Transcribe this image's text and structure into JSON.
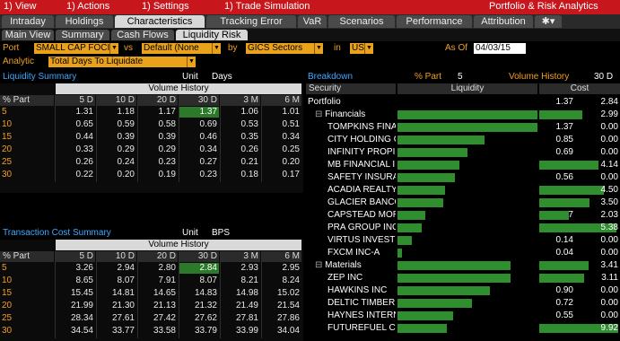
{
  "menu": {
    "view": "1) View",
    "actions": "1) Actions",
    "settings": "1) Settings",
    "trade_sim": "1) Trade Simulation",
    "app_title": "Portfolio & Risk Analytics"
  },
  "tabs": [
    "Intraday",
    "Holdings",
    "Characteristics",
    "Tracking Error",
    "VaR",
    "Scenarios",
    "Performance",
    "Attribution"
  ],
  "subtabs": [
    "Main View",
    "Summary",
    "Cash Flows",
    "Liquidity Risk"
  ],
  "filters": {
    "port_label": "Port",
    "port_value": "SMALL CAP FOCI",
    "vs_label": "vs",
    "vs_value": "Default (None",
    "by_label": "by",
    "by_value": "GICS Sectors",
    "in_label": "in",
    "in_value": "USD",
    "asof_label": "As Of",
    "asof_value": "04/03/15",
    "analytic_label": "Analytic",
    "analytic_value": "Total Days To Liquidate"
  },
  "liquidity_summary": {
    "title": "Liquidity Summary",
    "unit_label": "Unit",
    "unit_value": "Days",
    "group_header": "Volume History",
    "columns": [
      "% Part",
      "5 D",
      "10 D",
      "20 D",
      "30 D",
      "3 M",
      "6 M"
    ],
    "rows": [
      [
        "5",
        "1.31",
        "1.18",
        "1.17",
        "1.37",
        "1.06",
        "1.01"
      ],
      [
        "10",
        "0.65",
        "0.59",
        "0.58",
        "0.69",
        "0.53",
        "0.51"
      ],
      [
        "15",
        "0.44",
        "0.39",
        "0.39",
        "0.46",
        "0.35",
        "0.34"
      ],
      [
        "20",
        "0.33",
        "0.29",
        "0.29",
        "0.34",
        "0.26",
        "0.25"
      ],
      [
        "25",
        "0.26",
        "0.24",
        "0.23",
        "0.27",
        "0.21",
        "0.20"
      ],
      [
        "30",
        "0.22",
        "0.20",
        "0.19",
        "0.23",
        "0.18",
        "0.17"
      ]
    ]
  },
  "transaction_cost": {
    "title": "Transaction Cost Summary",
    "unit_label": "Unit",
    "unit_value": "BPS",
    "group_header": "Volume History",
    "columns": [
      "% Part",
      "5 D",
      "10 D",
      "20 D",
      "30 D",
      "3 M",
      "6 M"
    ],
    "rows": [
      [
        "5",
        "3.26",
        "2.94",
        "2.80",
        "2.84",
        "2.93",
        "2.95"
      ],
      [
        "10",
        "8.65",
        "8.07",
        "7.91",
        "8.07",
        "8.21",
        "8.24"
      ],
      [
        "15",
        "15.45",
        "14.81",
        "14.65",
        "14.83",
        "14.98",
        "15.02"
      ],
      [
        "20",
        "21.99",
        "21.30",
        "21.13",
        "21.32",
        "21.49",
        "21.54"
      ],
      [
        "25",
        "28.34",
        "27.61",
        "27.42",
        "27.62",
        "27.81",
        "27.86"
      ],
      [
        "30",
        "34.54",
        "33.77",
        "33.58",
        "33.79",
        "33.99",
        "34.04"
      ]
    ]
  },
  "breakdown": {
    "title": "Breakdown",
    "part_label": "% Part",
    "part_value": "5",
    "vol_label": "Volume History",
    "vol_value": "30 D",
    "columns": [
      "Security",
      "Liquidity",
      "Cost"
    ],
    "rows": [
      {
        "name": "Portfolio",
        "liq": "1.37",
        "cost": "2.84",
        "level": 0,
        "liqpct": 0,
        "costpct": 0
      },
      {
        "name": "Financials",
        "liq": "1.37",
        "cost": "2.99",
        "level": 1,
        "liqpct": 1.0,
        "costpct": 0.55
      },
      {
        "name": "TOMPKINS FINA",
        "liq": "1.37",
        "cost": "0.00",
        "level": 2,
        "liqpct": 1.0,
        "costpct": 0
      },
      {
        "name": "CITY HOLDING C",
        "liq": "0.85",
        "cost": "0.00",
        "level": 2,
        "liqpct": 0.62,
        "costpct": 0
      },
      {
        "name": "INFINITY PROPI",
        "liq": "0.69",
        "cost": "0.00",
        "level": 2,
        "liqpct": 0.5,
        "costpct": 0
      },
      {
        "name": "MB FINANCIAL I",
        "liq": "0.61",
        "cost": "4.14",
        "level": 2,
        "liqpct": 0.44,
        "costpct": 0.75
      },
      {
        "name": "SAFETY INSURA",
        "liq": "0.56",
        "cost": "0.00",
        "level": 2,
        "liqpct": 0.41,
        "costpct": 0
      },
      {
        "name": "ACADIA REALTY",
        "liq": "0.46",
        "cost": "4.50",
        "level": 2,
        "liqpct": 0.34,
        "costpct": 0.82
      },
      {
        "name": "GLACIER BANCO",
        "liq": "0.45",
        "cost": "3.50",
        "level": 2,
        "liqpct": 0.33,
        "costpct": 0.64
      },
      {
        "name": "CAPSTEAD MORT",
        "liq": "0.27",
        "cost": "2.03",
        "level": 2,
        "liqpct": 0.2,
        "costpct": 0.37
      },
      {
        "name": "PRA GROUP INC",
        "liq": "0.23",
        "cost": "5.38",
        "level": 2,
        "liqpct": 0.17,
        "costpct": 0.98
      },
      {
        "name": "VIRTUS INVESTI",
        "liq": "0.14",
        "cost": "0.00",
        "level": 2,
        "liqpct": 0.1,
        "costpct": 0
      },
      {
        "name": "FXCM INC-A",
        "liq": "0.04",
        "cost": "0.00",
        "level": 2,
        "liqpct": 0.03,
        "costpct": 0
      },
      {
        "name": "Materials",
        "liq": "1.11",
        "cost": "3.41",
        "level": 1,
        "liqpct": 0.81,
        "costpct": 0.62
      },
      {
        "name": "ZEP INC",
        "liq": "1.11",
        "cost": "3.11",
        "level": 2,
        "liqpct": 0.81,
        "costpct": 0.57
      },
      {
        "name": "HAWKINS INC",
        "liq": "0.90",
        "cost": "0.00",
        "level": 2,
        "liqpct": 0.66,
        "costpct": 0
      },
      {
        "name": "DELTIC TIMBER",
        "liq": "0.72",
        "cost": "0.00",
        "level": 2,
        "liqpct": 0.53,
        "costpct": 0
      },
      {
        "name": "HAYNES INTERN",
        "liq": "0.55",
        "cost": "0.00",
        "level": 2,
        "liqpct": 0.4,
        "costpct": 0
      },
      {
        "name": "FUTUREFUEL CO",
        "liq": "0.48",
        "cost": "9.92",
        "level": 2,
        "liqpct": 0.35,
        "costpct": 1.0
      }
    ]
  },
  "colors": {
    "menubar": "#c8161d",
    "orange": "#e9a21a",
    "blue_title": "#3fa8ff",
    "bar_green": "#2f8f2f",
    "highlight_green": "#2a7a2a"
  }
}
